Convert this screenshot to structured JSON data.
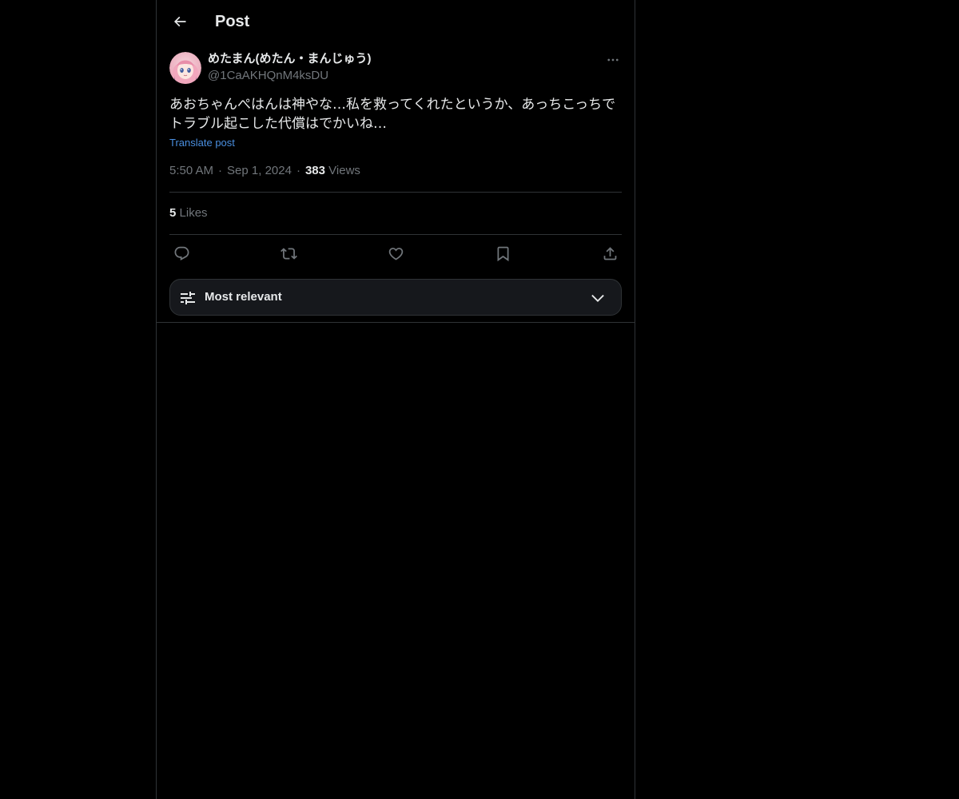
{
  "header": {
    "back_icon": "arrow-left-icon",
    "title": "Post"
  },
  "post": {
    "avatar_icon": "user-avatar",
    "display_name": "めたまん(めたん・まんじゅう)",
    "handle": "@1CaAKHQnM4ksDU",
    "more_icon": "more-horizontal-icon",
    "text": "あおちゃんぺはんは神やな…私を救ってくれたというか、あっちこっちで\nトラブル起こした代償はでかいね…",
    "translate_label": "Translate post",
    "time": "5:50 AM",
    "date": "Sep 1, 2024",
    "views_count": "383",
    "views_label": "Views",
    "likes_count": "5",
    "likes_label": "Likes"
  },
  "actions": [
    {
      "name": "reply",
      "icon": "reply-icon"
    },
    {
      "name": "repost",
      "icon": "repost-icon"
    },
    {
      "name": "like",
      "icon": "heart-icon"
    },
    {
      "name": "bookmark",
      "icon": "bookmark-icon"
    },
    {
      "name": "share",
      "icon": "share-icon"
    }
  ],
  "sort": {
    "icon": "sliders-icon",
    "label": "Most relevant",
    "chevron_icon": "chevron-down-icon"
  },
  "colors": {
    "background": "#000000",
    "text": "#e7e9ea",
    "muted": "#71767b",
    "link": "#4a8fe0",
    "border": "#2f3336"
  }
}
